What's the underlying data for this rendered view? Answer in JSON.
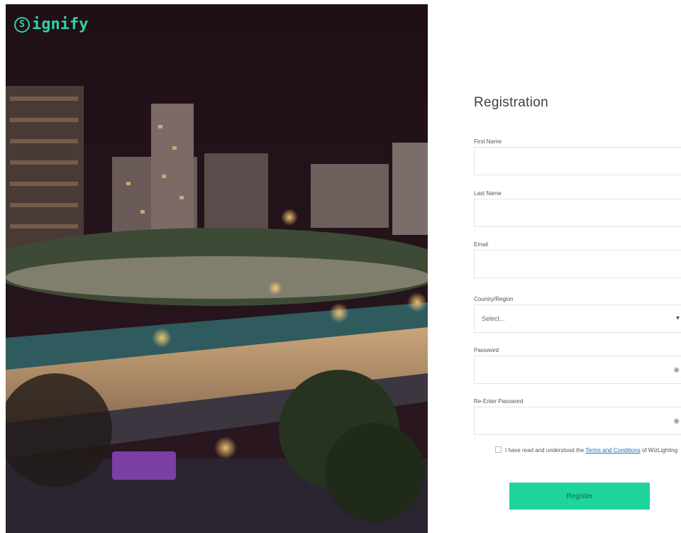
{
  "brand": {
    "logo_mark": "S",
    "logo_text": "ignify",
    "accent_color": "#1ed49c"
  },
  "form": {
    "title": "Registration",
    "first_name": {
      "label": "First Name",
      "value": "",
      "placeholder": ""
    },
    "last_name": {
      "label": "Last Name",
      "value": "",
      "placeholder": ""
    },
    "email": {
      "label": "Email",
      "value": "",
      "placeholder": ""
    },
    "country": {
      "label": "Country/Region",
      "selected": "Select..."
    },
    "password": {
      "label": "Password",
      "value": ""
    },
    "reenter_password": {
      "label": "Re-Enter Password",
      "value": ""
    },
    "terms": {
      "prefix": "I have read and understood the",
      "link": "Terms and Conditions",
      "suffix": "of WizLighting"
    },
    "register_label": "Register"
  },
  "icons": {
    "show_password": "eye-icon",
    "dropdown": "chevron-down-icon"
  }
}
